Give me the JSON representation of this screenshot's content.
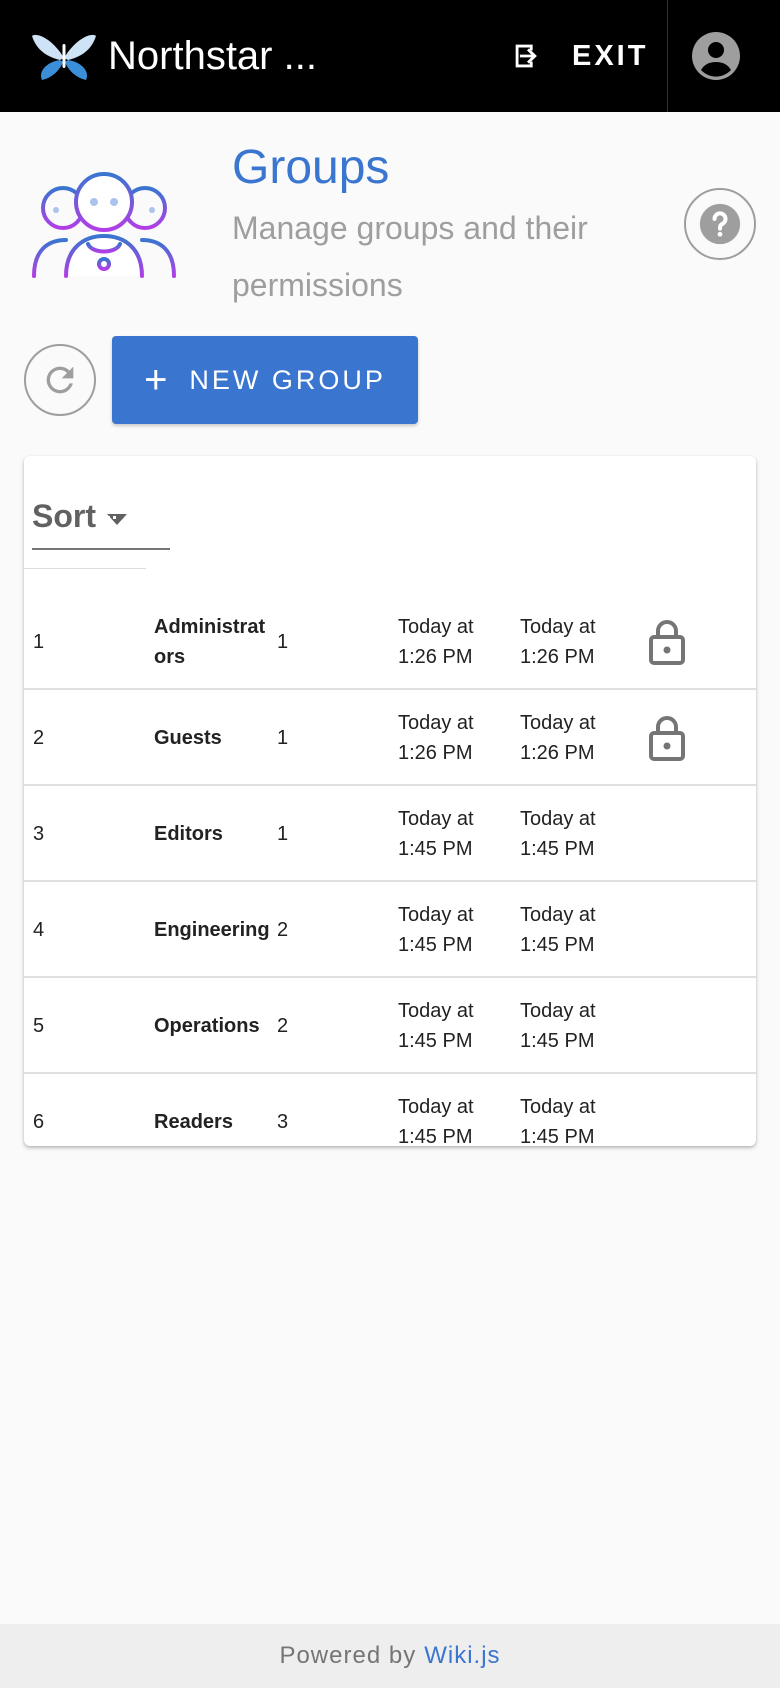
{
  "app": {
    "title": "Northstar ...",
    "logo_icon": "butterfly-logo"
  },
  "topbar": {
    "exit_label": "EXIT",
    "exit_icon": "exit-icon",
    "account_icon": "account-circle-icon"
  },
  "header": {
    "icon": "group-people-icon",
    "title": "Groups",
    "subtitle": "Manage groups and their permissions",
    "help_icon": "help-icon"
  },
  "actions": {
    "refresh_icon": "refresh-icon",
    "new_group_label": "NEW GROUP",
    "new_group_icon": "plus-icon"
  },
  "table": {
    "sort_label": "Sort",
    "sort_icon": "sort-dropdown-icon",
    "rows": [
      {
        "id": "1",
        "name": "Administrators",
        "users": "1",
        "created": "Today at 1:26 PM",
        "updated": "Today at 1:26 PM",
        "system": true
      },
      {
        "id": "2",
        "name": "Guests",
        "users": "1",
        "created": "Today at 1:26 PM",
        "updated": "Today at 1:26 PM",
        "system": true
      },
      {
        "id": "3",
        "name": "Editors",
        "users": "1",
        "created": "Today at 1:45 PM",
        "updated": "Today at 1:45 PM",
        "system": false
      },
      {
        "id": "4",
        "name": "Engineering",
        "users": "2",
        "created": "Today at 1:45 PM",
        "updated": "Today at 1:45 PM",
        "system": false
      },
      {
        "id": "5",
        "name": "Operations",
        "users": "2",
        "created": "Today at 1:45 PM",
        "updated": "Today at 1:45 PM",
        "system": false
      },
      {
        "id": "6",
        "name": "Readers",
        "users": "3",
        "created": "Today at 1:45 PM",
        "updated": "Today at 1:45 PM",
        "system": false
      }
    ]
  },
  "footer": {
    "prefix": "Powered by",
    "link_label": "Wiki.js"
  },
  "colors": {
    "accent": "#3a75cf",
    "topbar": "#000000",
    "icon_gradient_start": "#3a75cf",
    "icon_gradient_end": "#b23ee6"
  }
}
